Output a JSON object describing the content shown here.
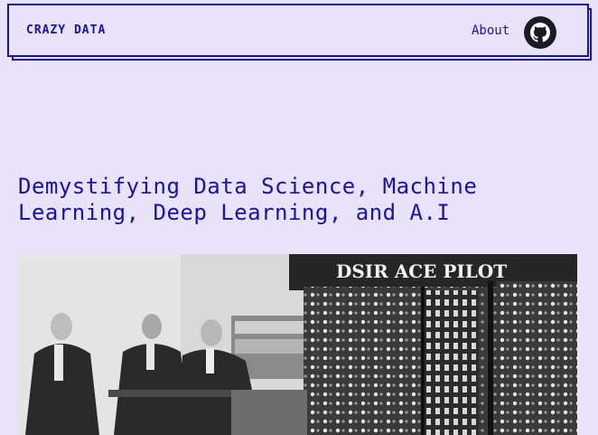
{
  "nav": {
    "logo": "CRAZY DATA",
    "about_label": "About",
    "github_icon": "github-icon"
  },
  "main": {
    "headline": "Demystifying Data Science, Machine Learning, Deep Learning, and A.I"
  },
  "hero": {
    "sign_text": "DSIR ACE PILOT"
  },
  "colors": {
    "background": "#e8e3fb",
    "accent": "#1a12a8",
    "github_button": "#1b1b25"
  }
}
